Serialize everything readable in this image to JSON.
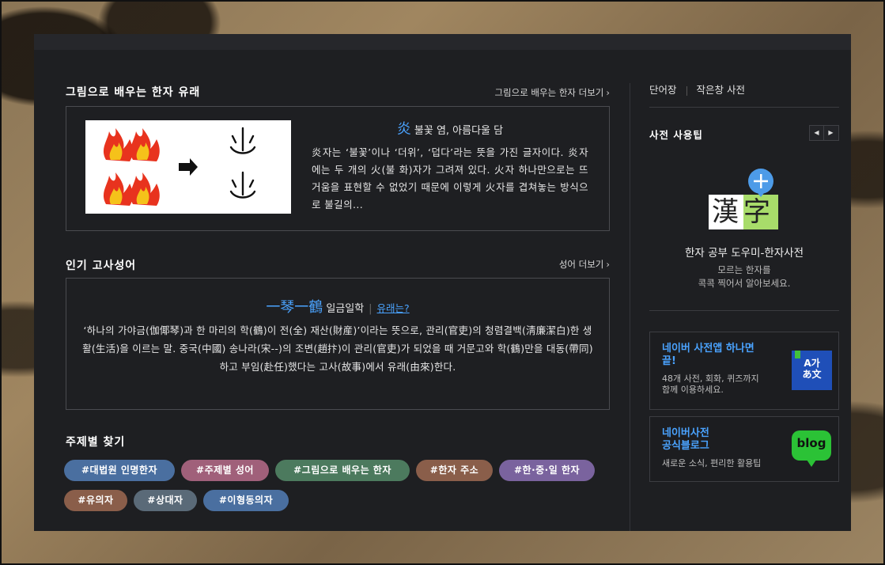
{
  "section_picture": {
    "title": "그림으로 배우는 한자 유래",
    "more": "그림으로 배우는 한자 더보기",
    "hanja": "炎",
    "reading": "불꽃 염, 아름다울 담",
    "description": "炎자는 ‘불꽃’이나 ‘더위’, ‘덥다’라는 뜻을 가진 글자이다. 炎자에는 두 개의 火(불 화)자가 그려져 있다. 火자 하나만으로는 뜨거움을 표현할 수 없었기 때문에 이렇게 火자를 겹쳐놓는 방식으로 불길의..."
  },
  "section_idiom": {
    "title": "인기 고사성어",
    "more": "성어 더보기",
    "hanja": "一琴一鶴",
    "reading": "일금일학",
    "origin_link": "유래는?",
    "description": "‘하나의 가야금(伽倻琴)과 한 마리의 학(鶴)이 전(全) 재산(財産)’이라는 뜻으로, 관리(官吏)의 청렴결백(淸廉潔白)한 생활(生活)을 이르는 말. 중국(中國) 송나라(宋--)의 조변(趙抃)이 관리(官吏)가 되었을 때 거문고와 학(鶴)만을 대동(帶同)하고 부임(赴任)했다는 고사(故事)에서 유래(由來)한다."
  },
  "section_topics": {
    "title": "주제별 찾기",
    "tags": [
      {
        "label": "#대법원 인명한자",
        "color": "#4a6fa0"
      },
      {
        "label": "#주제별 성어",
        "color": "#a0607a"
      },
      {
        "label": "#그림으로 배우는 한자",
        "color": "#4c7a5e"
      },
      {
        "label": "#한자 주소",
        "color": "#8a5e4a"
      },
      {
        "label": "#한·중·일 한자",
        "color": "#7a639e"
      },
      {
        "label": "#유의자",
        "color": "#8a5e4a"
      },
      {
        "label": "#상대자",
        "color": "#5a6a78"
      },
      {
        "label": "#이형동의자",
        "color": "#4a6fa0"
      }
    ]
  },
  "sidebar": {
    "tab_wordbook": "단어장",
    "tab_mini": "작은창 사전",
    "tip_title": "사전 사용팁",
    "logo_chars": "漢字",
    "tip_name": "한자 공부 도우미-한자사전",
    "tip_desc_1": "모르는 한자를",
    "tip_desc_2": "콕콕 찍어서 알아보세요.",
    "card_app": {
      "title_1": "네이버 사전앱 하나면",
      "title_2": "끝!",
      "desc_1": "48개 사전, 회화, 퀴즈까지",
      "desc_2": "함께 이용하세요.",
      "badge_top": "A가",
      "badge_bottom": "あ文"
    },
    "card_blog": {
      "title_1": "네이버사전",
      "title_2": "공식블로그",
      "desc": "새로운 소식, 편리한 활용팁",
      "badge": "blog"
    }
  }
}
